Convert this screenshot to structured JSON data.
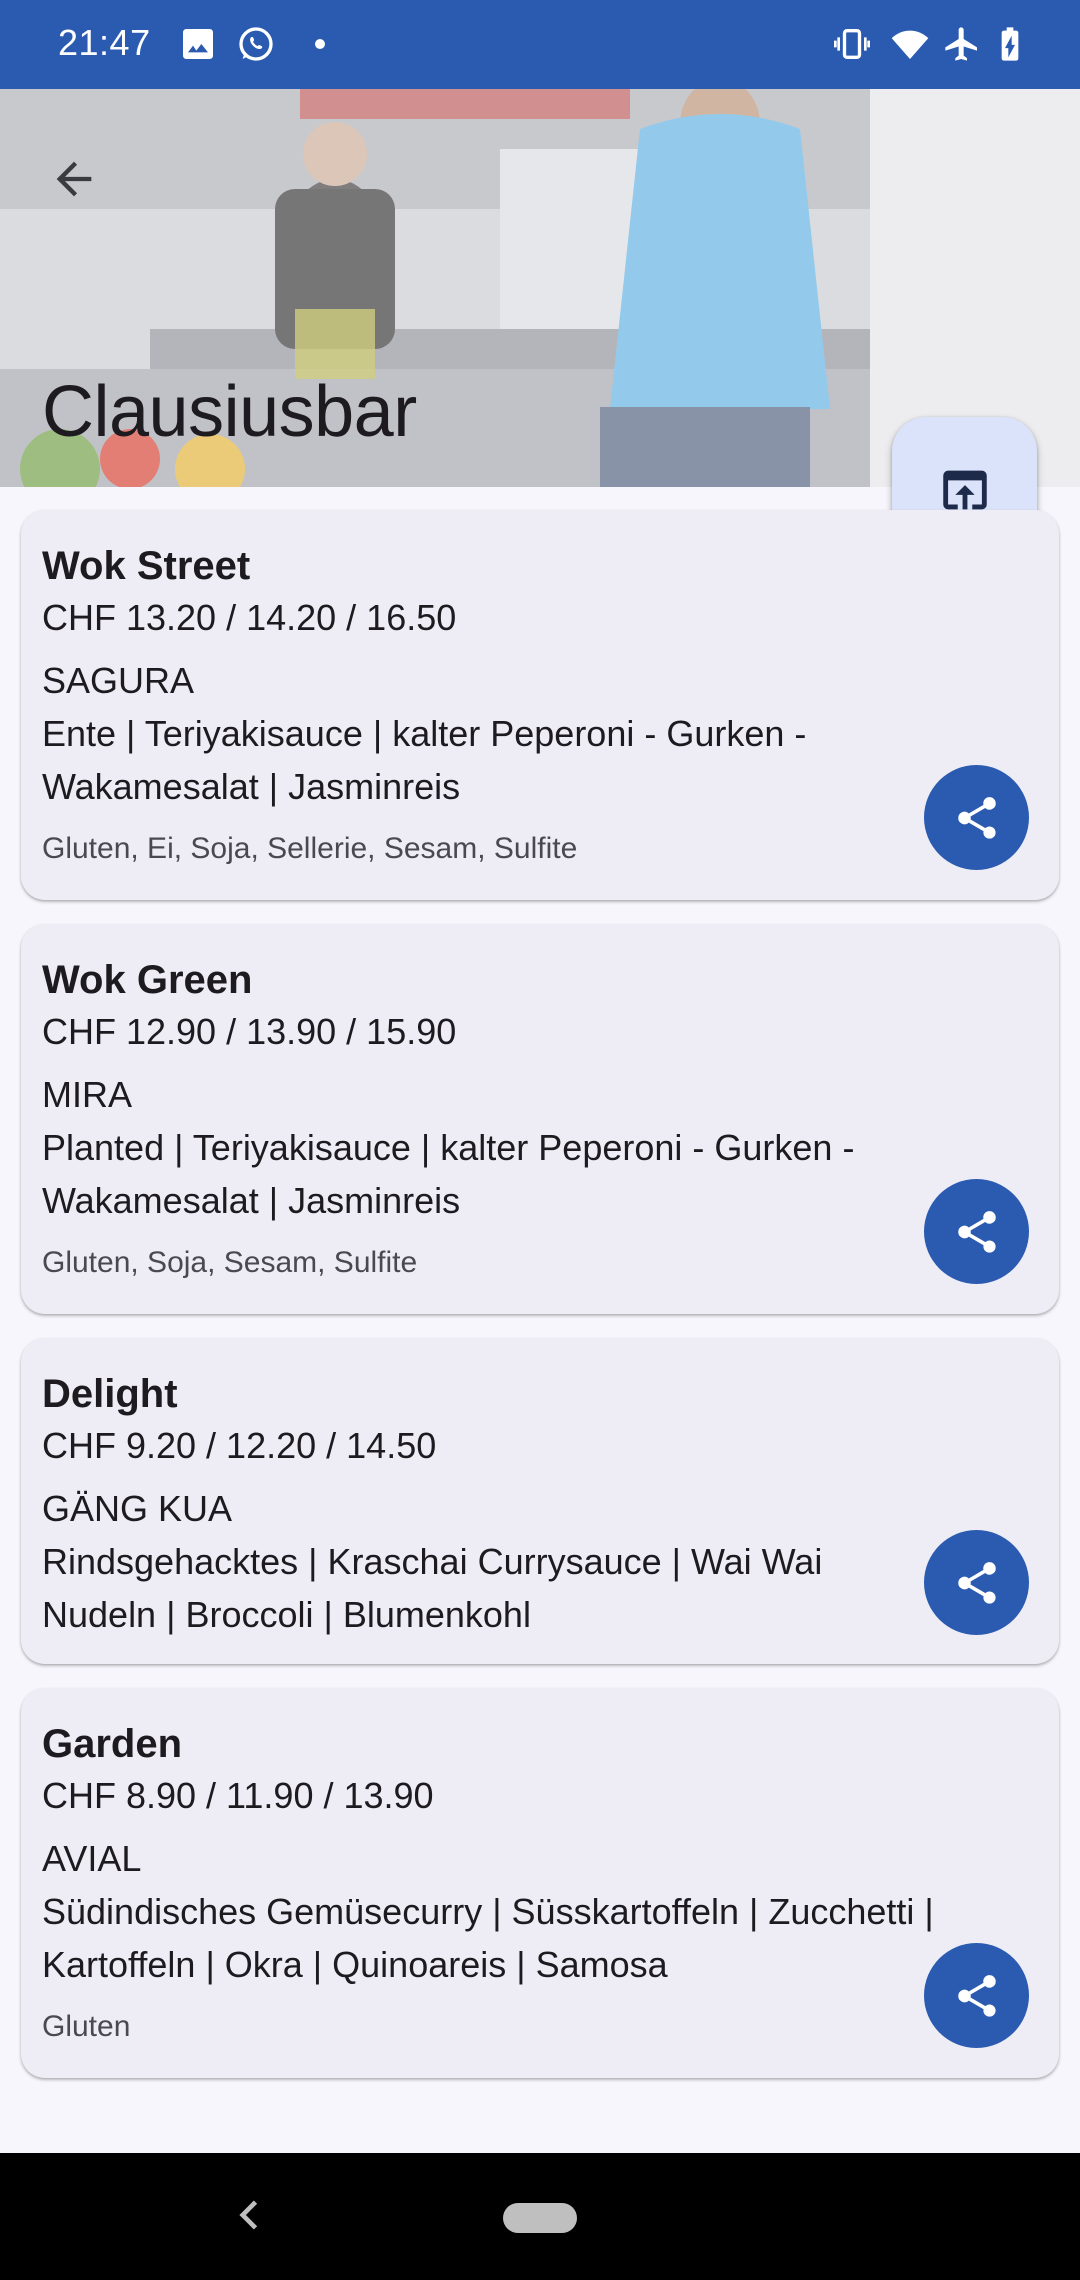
{
  "status_bar": {
    "time": "21:47",
    "left_icons": [
      "image-icon",
      "whatsapp-icon",
      "dot-icon"
    ],
    "right_icons": [
      "vibrate-icon",
      "wifi-icon",
      "airplane-icon",
      "battery-charging-icon"
    ]
  },
  "header": {
    "title": "Clausiusbar",
    "back_icon": "arrow-left-icon",
    "fab_icon": "open-in-browser-icon"
  },
  "menu": [
    {
      "name": "Wok Street",
      "price": "CHF 13.20 / 14.20 / 16.50",
      "dish_title": "SAGURA",
      "dish_description": "Ente | Teriyakisauce | kalter Peperoni - Gurken - Wakamesalat | Jasminreis",
      "allergens": "Gluten, Ei, Soja, Sellerie, Sesam, Sulfite"
    },
    {
      "name": "Wok Green",
      "price": "CHF 12.90 / 13.90 / 15.90",
      "dish_title": "MIRA",
      "dish_description": "Planted | Teriyakisauce | kalter Peperoni - Gurken - Wakamesalat | Jasminreis",
      "allergens": "Gluten, Soja, Sesam, Sulfite"
    },
    {
      "name": "Delight",
      "price": "CHF 9.20 / 12.20 / 14.50",
      "dish_title": "GÄNG KUA",
      "dish_description": "Rindsgehacktes | Kraschai Currysauce | Wai Wai Nudeln | Broccoli | Blumenkohl",
      "allergens": ""
    },
    {
      "name": "Garden",
      "price": "CHF 8.90 / 11.90 / 13.90",
      "dish_title": "AVIAL",
      "dish_description": "Südindisches Gemüsecurry | Süsskartoffeln | Zucchetti | Kartoffeln | Okra | Quinoareis | Samosa",
      "allergens": "Gluten"
    }
  ],
  "colors": {
    "primary": "#2a5bb0",
    "card_bg": "#eeedf5",
    "fab_bg": "#dbe3fb",
    "page_bg": "#f7f6fc"
  }
}
